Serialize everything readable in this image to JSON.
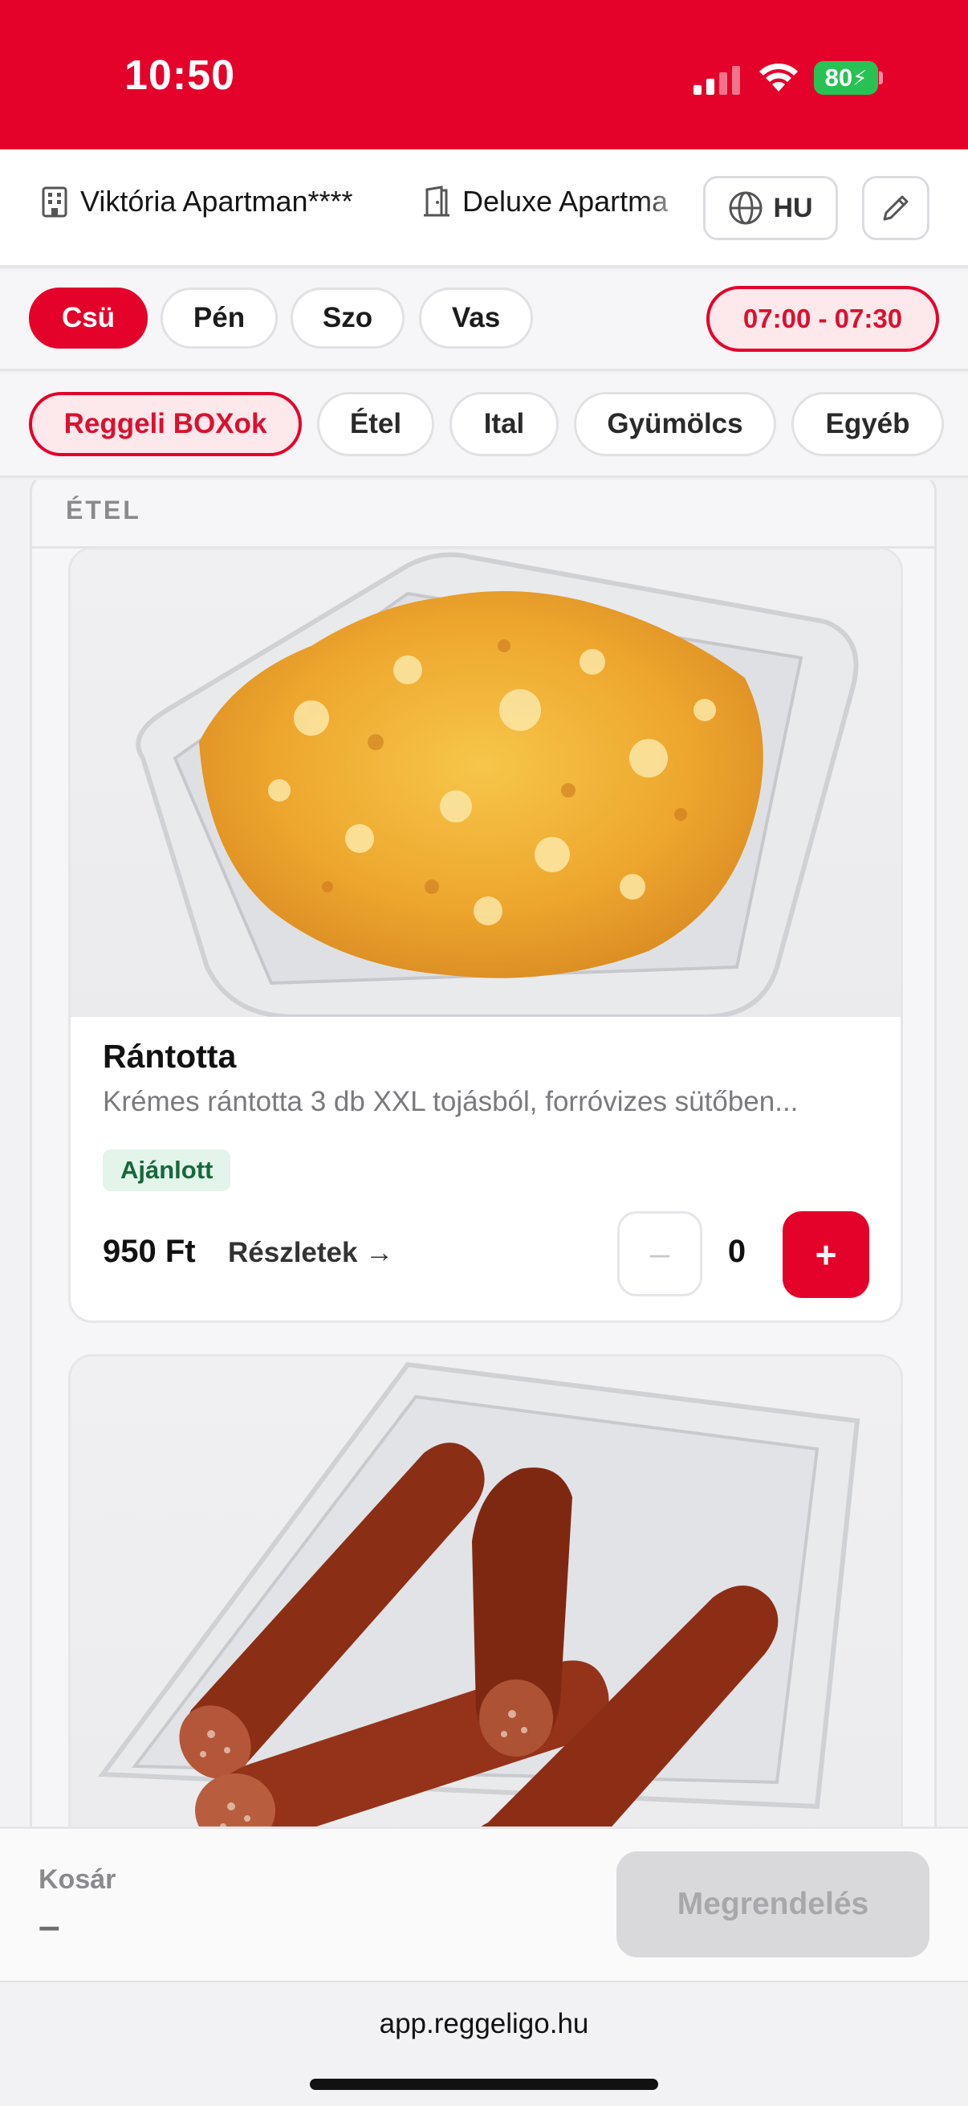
{
  "status_bar": {
    "time": "10:50",
    "battery": "80",
    "icons": [
      "signal-icon",
      "wifi-icon",
      "battery-charging-icon"
    ]
  },
  "header": {
    "property_1": "Viktória Apartman****",
    "property_2": "Deluxe Apartma",
    "language": "HU",
    "icons": [
      "building-icon",
      "door-icon",
      "globe-icon",
      "pencil-icon"
    ]
  },
  "days": [
    {
      "label": "Csü",
      "active": true
    },
    {
      "label": "Pén",
      "active": false
    },
    {
      "label": "Szo",
      "active": false
    },
    {
      "label": "Vas",
      "active": false
    }
  ],
  "time_slot": "07:00 - 07:30",
  "categories": [
    {
      "label": "Reggeli BOXok",
      "active": true
    },
    {
      "label": "Étel",
      "active": false
    },
    {
      "label": "Ital",
      "active": false
    },
    {
      "label": "Gyümölcs",
      "active": false
    },
    {
      "label": "Egyéb",
      "active": false
    }
  ],
  "section": {
    "title": "ÉTEL"
  },
  "products": [
    {
      "title": "Rántotta",
      "description": "Krémes rántotta 3 db XXL tojásból, forróvizes sütőben...",
      "badge": "Ajánlott",
      "price": "950 Ft",
      "details_link": "Részletek →",
      "quantity": "0",
      "minus_label": "–",
      "plus_label": "+"
    }
  ],
  "cart": {
    "label": "Kosár",
    "value": "–",
    "order_button": "Megrendelés"
  },
  "browser": {
    "url": "app.reggeligo.hu"
  },
  "colors": {
    "brand_red": "#e4022b",
    "badge_green": "#17673a",
    "badge_green_bg": "#e3f4ea"
  }
}
